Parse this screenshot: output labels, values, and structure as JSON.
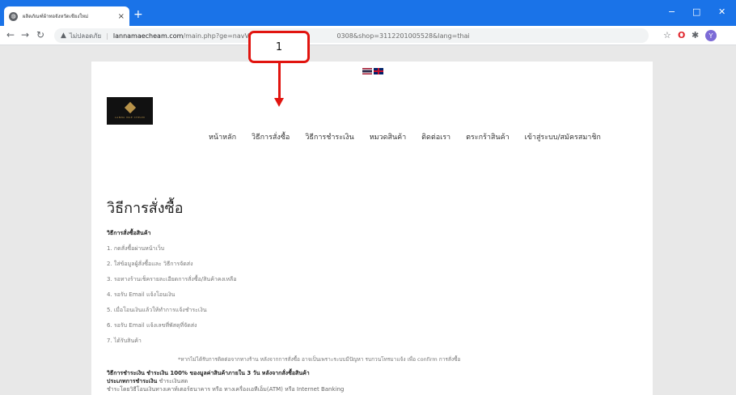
{
  "browser": {
    "tab_title": "ผลิตภัณฑ์ผ้าทอจังหวัดเชียงใหม่",
    "new_tab": "+",
    "address_insecure": "ไม่ปลอดภัย",
    "url_domain": "lannamaecheam.com",
    "url_path_start": "/main.php?ge=navView",
    "url_path_end": "0308&shop=3112201005528&lang=thai",
    "window_minimize": "−",
    "window_maximize": "□",
    "window_close": "✕"
  },
  "site": {
    "logo_text": "LANNA MAE CHEAM",
    "menu": [
      "หน้าหลัก",
      "วิธีการสั่งซื้อ",
      "วิธีการชำระเงิน",
      "หมวดสินค้า",
      "ติดต่อเรา",
      "ตระกร้าสินค้า",
      "เข้าสู่ระบบ/สมัครสมาชิก"
    ]
  },
  "content": {
    "title": "วิธีการสั่งซื้อ",
    "section_heading": "วิธีการสั่งซื้อสินค้า",
    "steps": [
      "1. กดสั่งซื้อผ่านหน้าเว็บ",
      "2. ใส่ข้อมูลผู้สั่งซื้อและ วิธีการจัดส่ง",
      "3. รอทางร้านเช็ครายละเอียดการสั่งซื้อ/สินค้าคงเหลือ",
      "4. รอรับ Email แจ้งโอนเงิน",
      "5. เมื่อโอนเงินแล้วให้ทำการแจ้งชำระเงิน",
      "6. รอรับ Email แจ้งเลขที่พัสดุที่จัดส่ง",
      "7. ได้รับสินค้า"
    ],
    "note": "*หากไม่ได้รับการติดต่อจากทางร้าน หลังจากการสั่งซื้อ อาจเป็นเพราะระบบมีปัญหา รบกวนโทรมาแจ้ง เพื่อ confirm การสั่งซื้อ",
    "payment_label": "วิธีการชำระเงิน",
    "payment_text": "ชำระเงิน 100% ของมูลค่าสินค้าภายใน 3 วัน หลังจากสั่งซื้อสินค้า",
    "payment_type_label": "ประเภทการชำระเงิน",
    "payment_type_value": "ชำระเงินสด",
    "payment_channels": "ชำระโดยวิธีโอนเงินทางเคาท์เตอร์ธนาคาร หรือ ทางเครื่องเอทีเอ็ม(ATM) หรือ Internet Banking"
  },
  "annotation": {
    "label": "1"
  }
}
